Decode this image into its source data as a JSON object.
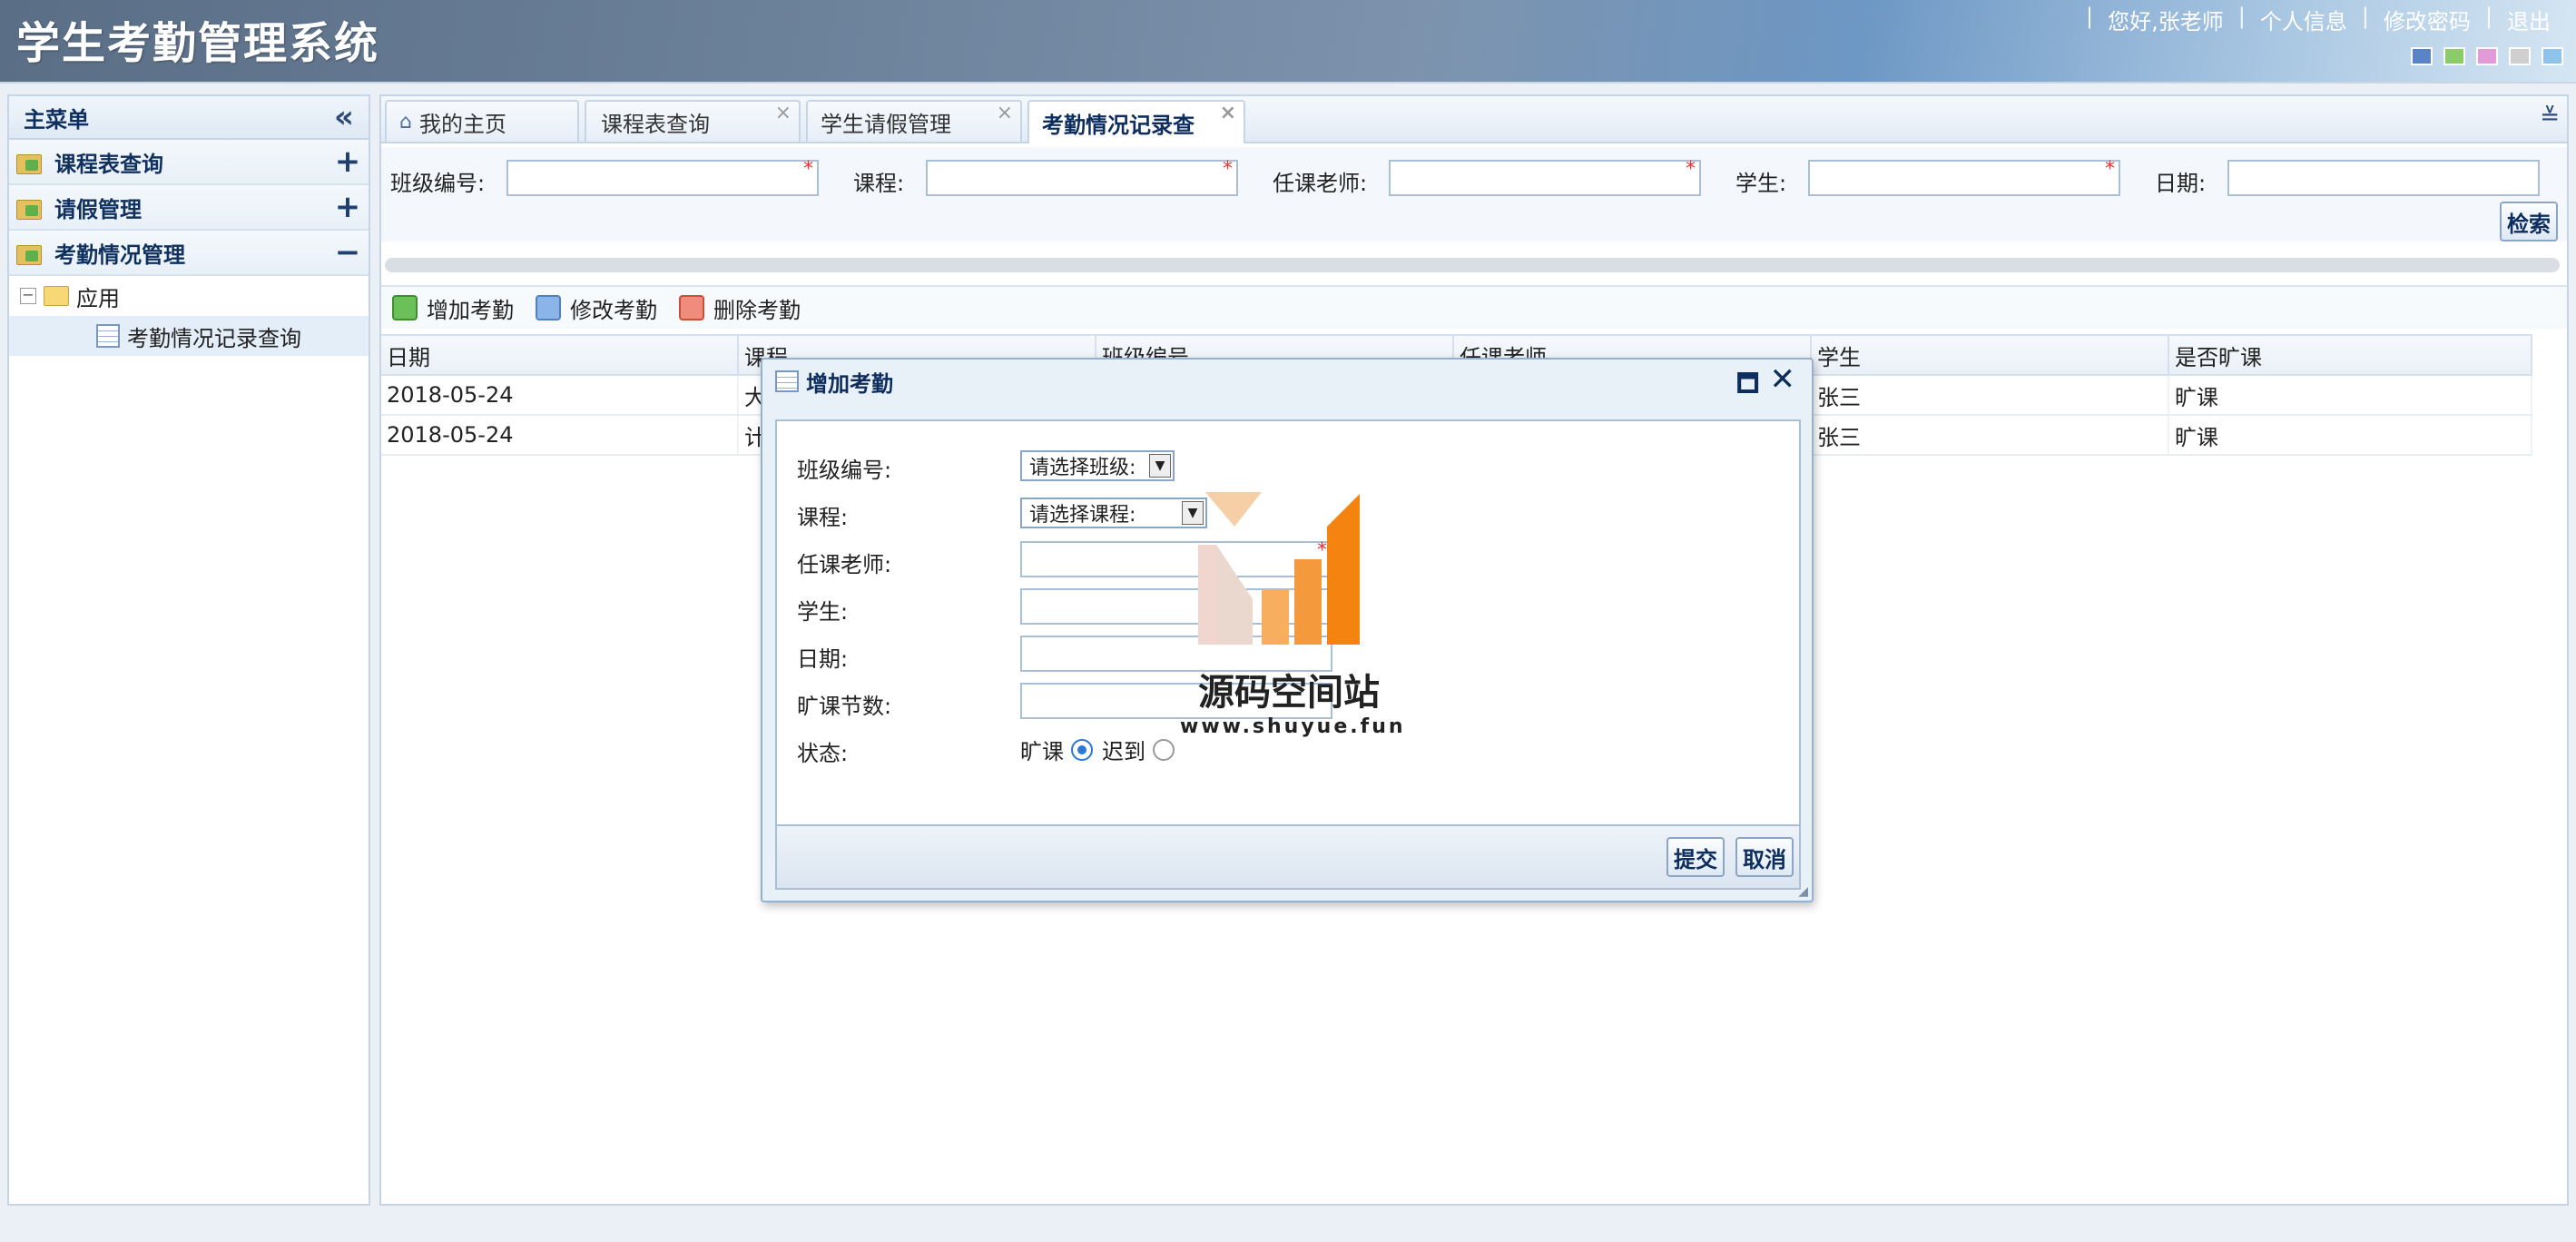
{
  "app": {
    "title": "学生考勤管理系统"
  },
  "top_links": {
    "greeting": "您好,张老师",
    "profile": "个人信息",
    "change_password": "修改密码",
    "logout": "退出",
    "separator": "|"
  },
  "themes": [
    "#5b84c4",
    "#8ccb6a",
    "#e39ad8",
    "#cfcfcf",
    "#8fc3ea"
  ],
  "sidebar": {
    "title": "主菜单",
    "menus": [
      {
        "label": "课程表查询",
        "state": "+"
      },
      {
        "label": "请假管理",
        "state": "+"
      },
      {
        "label": "考勤情况管理",
        "state": "−"
      }
    ],
    "tree": {
      "toggle": "−",
      "folder": "应用",
      "leaf": "考勤情况记录查询"
    }
  },
  "tabs": [
    {
      "label": "我的主页"
    },
    {
      "label": "课程表查询",
      "close": "×"
    },
    {
      "label": "学生请假管理",
      "close": "×"
    },
    {
      "label": "考勤情况记录查",
      "close": "×"
    }
  ],
  "search": {
    "class_label": "班级编号:",
    "course_label": "课程:",
    "teacher_label": "任课老师:",
    "student_label": "学生:",
    "date_label": "日期:",
    "required_mark": "*",
    "search_button": "检索"
  },
  "toolbar": {
    "add": "增加考勤",
    "edit": "修改考勤",
    "delete": "删除考勤"
  },
  "grid": {
    "columns": [
      "日期",
      "课程",
      "班级编号",
      "任课老师",
      "学生",
      "是否旷课"
    ],
    "rows": [
      [
        "2018-05-24",
        "大",
        "",
        "",
        "张三",
        "旷课"
      ],
      [
        "2018-05-24",
        "计",
        "",
        "",
        "张三",
        "旷课"
      ]
    ]
  },
  "dialog": {
    "title": "增加考勤",
    "class_label": "班级编号:",
    "class_select": "请选择班级:",
    "course_label": "课程:",
    "course_select": "请选择课程:",
    "teacher_label": "任课老师:",
    "student_label": "学生:",
    "date_label": "日期:",
    "absent_count_label": "旷课节数:",
    "status_label": "状态:",
    "status_options": [
      "旷课",
      "迟到"
    ],
    "status_selected": "旷课",
    "submit": "提交",
    "cancel": "取消"
  },
  "watermark": {
    "title": "源码空间站",
    "url": "www.shuyue.fun"
  }
}
